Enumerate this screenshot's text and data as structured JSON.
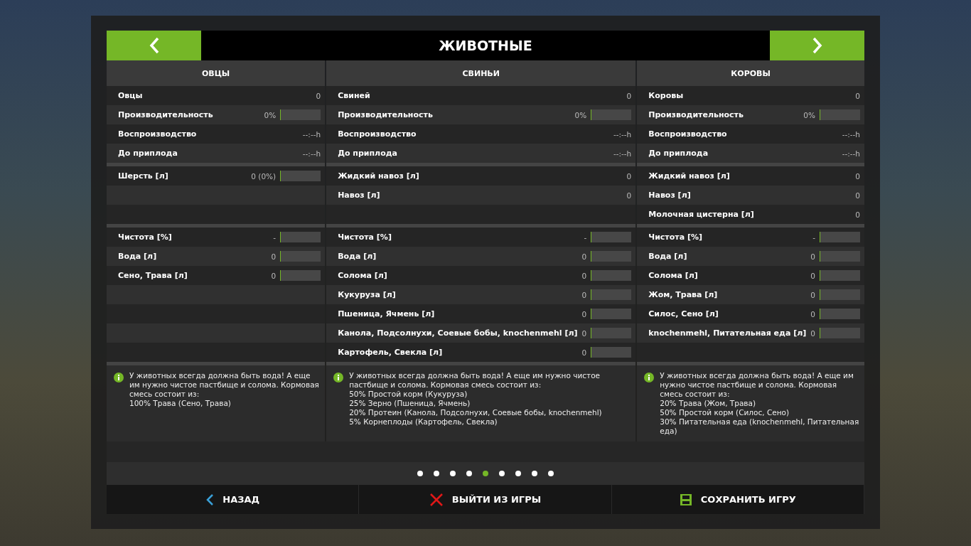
{
  "header": {
    "title": "ЖИВОТНЫЕ"
  },
  "columns": [
    {
      "title": "ОВЦЫ",
      "sections": [
        [
          {
            "kind": "plain",
            "label": "Овцы",
            "value": "0"
          },
          {
            "kind": "meter",
            "label": "Производительность",
            "value": "0%",
            "level": 0
          },
          {
            "kind": "plain",
            "label": "Воспроизводство",
            "value": "--:--h"
          },
          {
            "kind": "plain",
            "label": "До приплода",
            "value": "--:--h"
          }
        ],
        [
          {
            "kind": "meter",
            "label": "Шерсть [л]",
            "value": "0 (0%)",
            "level": 0
          },
          {
            "kind": "empty"
          },
          {
            "kind": "empty"
          }
        ],
        [
          {
            "kind": "meter",
            "label": "Чистота [%]",
            "value": "-",
            "level": 0
          },
          {
            "kind": "meter",
            "label": "Вода [л]",
            "value": "0",
            "level": 0
          },
          {
            "kind": "meter",
            "label": "Сено, Трава [л]",
            "value": "0",
            "level": 0
          },
          {
            "kind": "empty"
          },
          {
            "kind": "empty"
          },
          {
            "kind": "empty"
          },
          {
            "kind": "empty"
          }
        ]
      ],
      "info": [
        "У животных всегда должна быть вода! А еще им нужно чистое пастбище и солома. Кормовая смесь состоит из:",
        "100% Трава (Сено, Трава)"
      ]
    },
    {
      "title": "СВИНЬИ",
      "sections": [
        [
          {
            "kind": "plain",
            "label": "Свиней",
            "value": "0"
          },
          {
            "kind": "meter",
            "label": "Производительность",
            "value": "0%",
            "level": 0
          },
          {
            "kind": "plain",
            "label": "Воспроизводство",
            "value": "--:--h"
          },
          {
            "kind": "plain",
            "label": "До приплода",
            "value": "--:--h"
          }
        ],
        [
          {
            "kind": "plain",
            "label": "Жидкий навоз [л]",
            "value": "0"
          },
          {
            "kind": "plain",
            "label": "Навоз [л]",
            "value": "0"
          },
          {
            "kind": "empty"
          }
        ],
        [
          {
            "kind": "meter",
            "label": "Чистота [%]",
            "value": "-",
            "level": 0
          },
          {
            "kind": "meter",
            "label": "Вода [л]",
            "value": "0",
            "level": 0
          },
          {
            "kind": "meter",
            "label": "Солома [л]",
            "value": "0",
            "level": 0
          },
          {
            "kind": "meter",
            "label": "Кукуруза [л]",
            "value": "0",
            "level": 0
          },
          {
            "kind": "meter",
            "label": "Пшеница, Ячмень [л]",
            "value": "0",
            "level": 0
          },
          {
            "kind": "meter",
            "label": "Канола, Подсолнухи, Соевые бобы, knochenmehl [л]",
            "value": "0",
            "level": 0
          },
          {
            "kind": "meter",
            "label": "Картофель, Свекла [л]",
            "value": "0",
            "level": 0
          }
        ]
      ],
      "info": [
        "У животных всегда должна быть вода! А еще им нужно чистое пастбище и солома. Кормовая смесь состоит из:",
        "50% Простой корм (Кукуруза)",
        "25% Зерно (Пшеница, Ячмень)",
        "20% Протеин (Канола, Подсолнухи, Соевые бобы, knochenmehl)",
        "5% Корнеплоды (Картофель, Свекла)"
      ]
    },
    {
      "title": "КОРОВЫ",
      "sections": [
        [
          {
            "kind": "plain",
            "label": "Коровы",
            "value": "0"
          },
          {
            "kind": "meter",
            "label": "Производительность",
            "value": "0%",
            "level": 0
          },
          {
            "kind": "plain",
            "label": "Воспроизводство",
            "value": "--:--h"
          },
          {
            "kind": "plain",
            "label": "До приплода",
            "value": "--:--h"
          }
        ],
        [
          {
            "kind": "plain",
            "label": "Жидкий навоз [л]",
            "value": "0"
          },
          {
            "kind": "plain",
            "label": "Навоз [л]",
            "value": "0"
          },
          {
            "kind": "plain",
            "label": "Молочная цистерна [л]",
            "value": "0"
          }
        ],
        [
          {
            "kind": "meter",
            "label": "Чистота [%]",
            "value": "-",
            "level": 0
          },
          {
            "kind": "meter",
            "label": "Вода [л]",
            "value": "0",
            "level": 0
          },
          {
            "kind": "meter",
            "label": "Солома [л]",
            "value": "0",
            "level": 0
          },
          {
            "kind": "meter",
            "label": "Жом, Трава [л]",
            "value": "0",
            "level": 0
          },
          {
            "kind": "meter",
            "label": "Силос, Сено [л]",
            "value": "0",
            "level": 0
          },
          {
            "kind": "meter",
            "label": "knochenmehl, Питательная еда [л]",
            "value": "0",
            "level": 0
          },
          {
            "kind": "empty"
          }
        ]
      ],
      "info": [
        "У животных всегда должна быть вода! А еще им нужно чистое пастбище и солома. Кормовая смесь состоит из:",
        "20% Трава (Жом, Трава)",
        "50% Простой корм (Силос, Сено)",
        "30% Питательная еда (knochenmehl, Питательная еда)"
      ]
    }
  ],
  "pages": [
    {
      "selected": false
    },
    {
      "selected": false
    },
    {
      "selected": false
    },
    {
      "selected": false
    },
    {
      "selected": true
    },
    {
      "selected": false
    },
    {
      "selected": false
    },
    {
      "selected": false
    },
    {
      "selected": false
    }
  ],
  "actions": [
    {
      "kind": "back",
      "label": "НАЗАД"
    },
    {
      "kind": "quit",
      "label": "ВЫЙТИ ИЗ ИГРЫ"
    },
    {
      "kind": "save",
      "label": "СОХРАНИТЬ ИГРУ"
    }
  ]
}
